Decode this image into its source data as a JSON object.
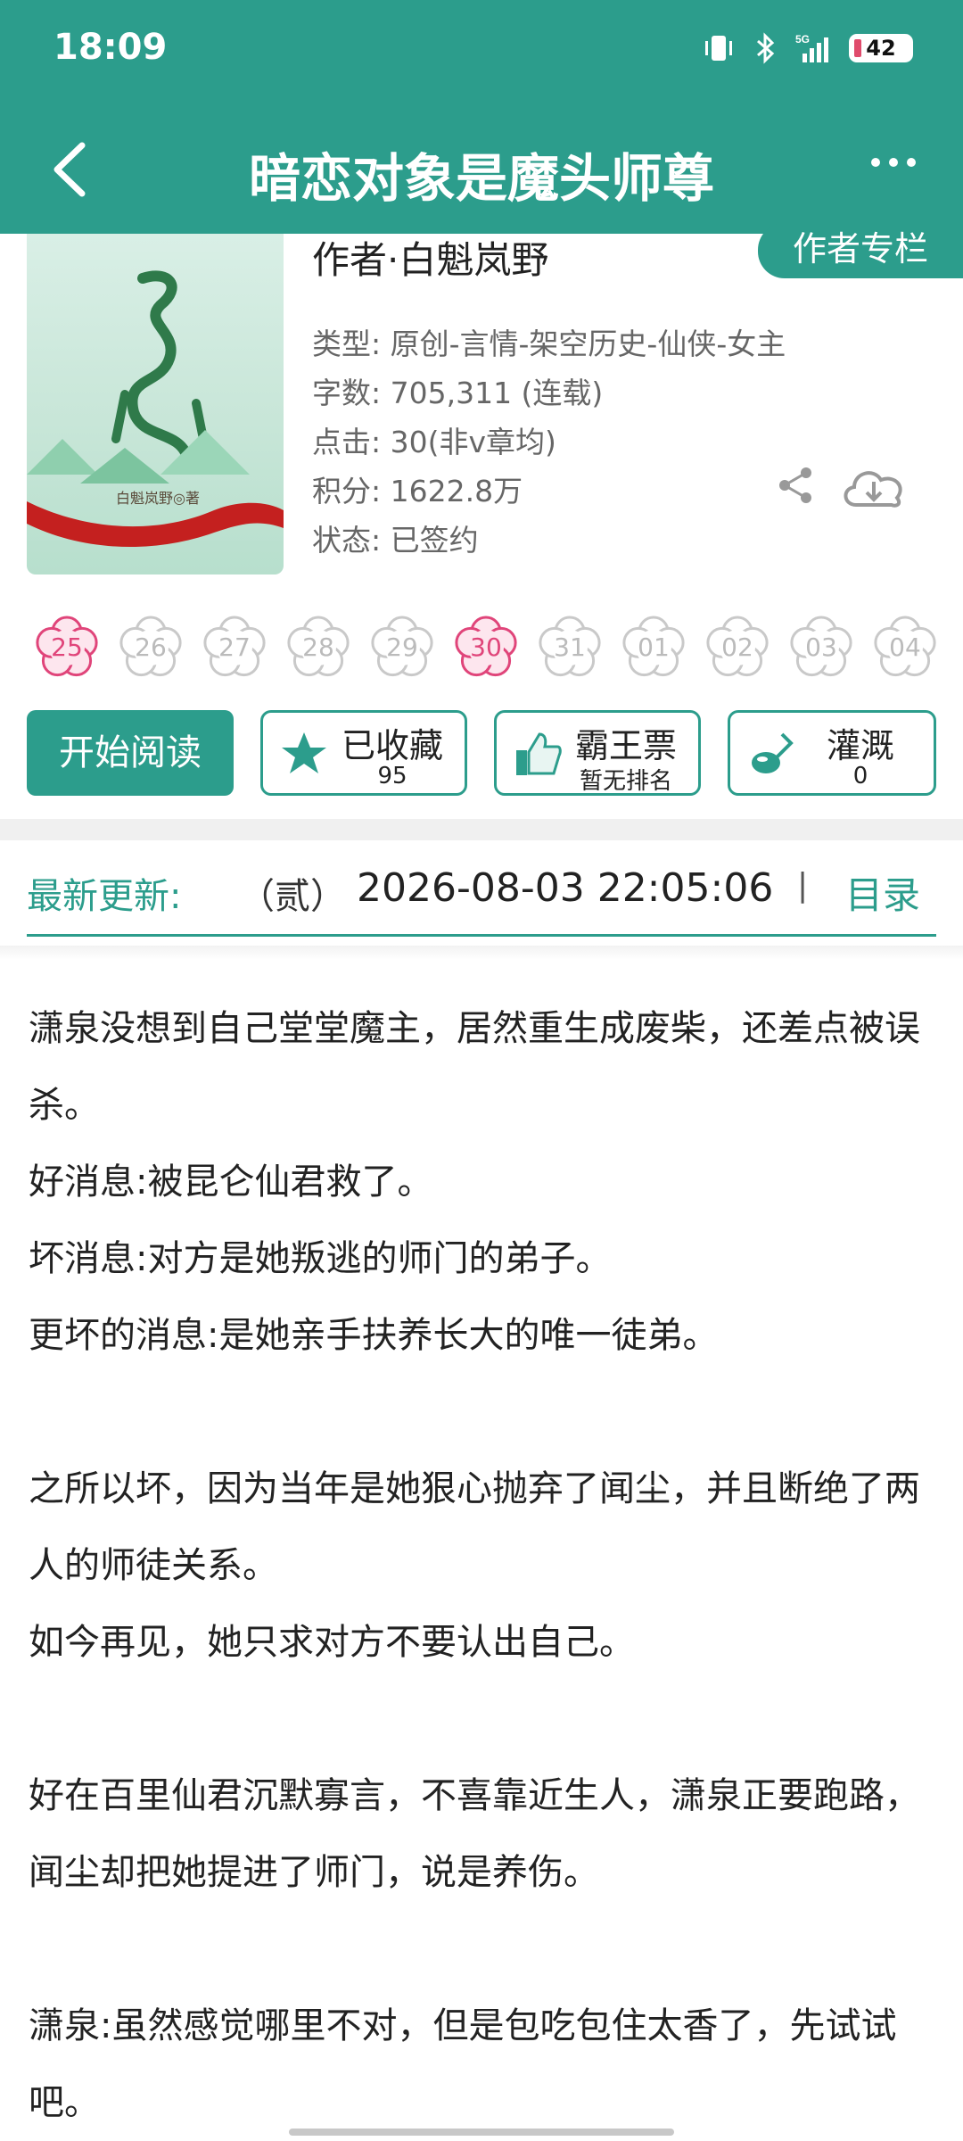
{
  "status_bar": {
    "time": "18:09",
    "battery": "42",
    "network": "5G"
  },
  "nav": {
    "title": "暗恋对象是魔头师尊"
  },
  "book": {
    "cover_author": "白魁岚野◎著",
    "author_line": "作者·白魁岚野",
    "author_column_label": "作者专栏",
    "meta": {
      "type": "类型: 原创-言情-架空历史-仙侠-女主",
      "words": "字数: 705,311 (连载)",
      "clicks": "点击: 30(非v章均)",
      "score": "积分: 1622.8万",
      "status": "状态: 已签约"
    }
  },
  "flowers": [
    {
      "label": "25",
      "active": true
    },
    {
      "label": "26",
      "active": false
    },
    {
      "label": "27",
      "active": false
    },
    {
      "label": "28",
      "active": false
    },
    {
      "label": "29",
      "active": false
    },
    {
      "label": "30",
      "active": true
    },
    {
      "label": "31",
      "active": false
    },
    {
      "label": "01",
      "active": false
    },
    {
      "label": "02",
      "active": false
    },
    {
      "label": "03",
      "active": false
    },
    {
      "label": "04",
      "active": false
    }
  ],
  "actions": {
    "read": "开始阅读",
    "collect": {
      "label": "已收藏",
      "count": "95"
    },
    "ticket": {
      "label": "霸王票",
      "sub": "暂无排名"
    },
    "water": {
      "label": "灌溉",
      "count": "0"
    }
  },
  "latest": {
    "label": "最新更新:",
    "chapter": "（贰）",
    "datetime": "2026-08-03 22:05:06",
    "separator": "|",
    "toc": "目录"
  },
  "synopsis": [
    "潇泉没想到自己堂堂魔主，居然重生成废柴，还差点被误杀。",
    "好消息:被昆仑仙君救了。",
    "坏消息:对方是她叛逃的师门的弟子。",
    "更坏的消息:是她亲手扶养长大的唯一徒弟。",
    "",
    "之所以坏，因为当年是她狠心抛弃了闻尘，并且断绝了两人的师徒关系。",
    "如今再见，她只求对方不要认出自己。",
    "",
    "好在百里仙君沉默寡言，不喜靠近生人，潇泉正要跑路，闻尘却把她提进了师门，说是养伤。",
    "",
    "潇泉:虽然感觉哪里不对，但是包吃包住太香了，先试试吧。"
  ],
  "colors": {
    "accent": "#2c9d8c",
    "flower_active": "#e0457a",
    "flower_inactive": "#c9c9c9"
  }
}
